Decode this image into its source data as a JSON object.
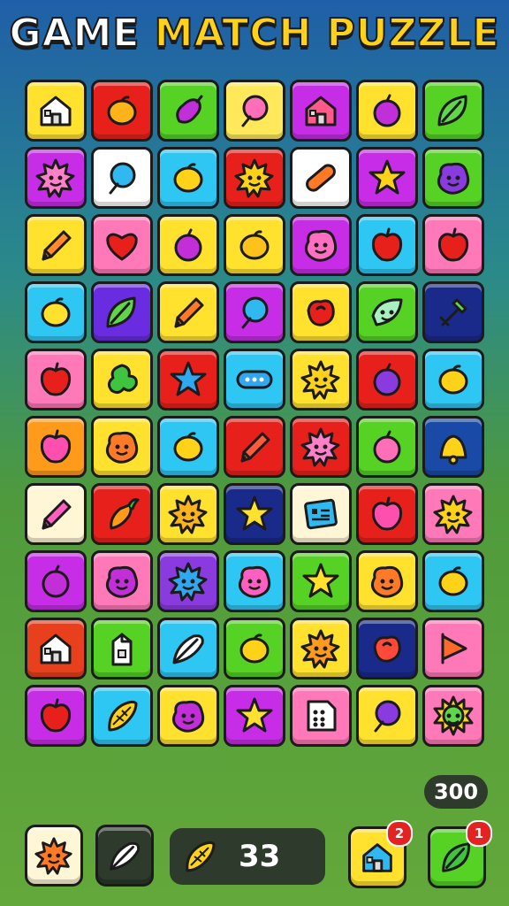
{
  "title": {
    "word1": "GAME",
    "word2": "MATCH PUZZLE"
  },
  "board": {
    "rows": [
      [
        {
          "bg": "#ffe12e",
          "icon": "house-icon",
          "color": "#ffffff"
        },
        {
          "bg": "#e8201c",
          "icon": "lemon-icon",
          "color": "#ffb31a"
        },
        {
          "bg": "#55d224",
          "icon": "eggplant-icon",
          "color": "#c22fd8"
        },
        {
          "bg": "#ffe95a",
          "icon": "balloon-icon",
          "color": "#ff6fb8"
        },
        {
          "bg": "#c72ce6",
          "icon": "house-icon",
          "color": "#ff5a8a"
        },
        {
          "bg": "#ffe12e",
          "icon": "plum-icon",
          "color": "#c22fd8"
        },
        {
          "bg": "#55d224",
          "icon": "leaf-icon",
          "color": "#62d64b"
        }
      ],
      [
        {
          "bg": "#c72ce6",
          "icon": "sun-face-icon",
          "color": "#ff7fc9"
        },
        {
          "bg": "#ffffff",
          "icon": "balloon-icon",
          "color": "#30b9f0"
        },
        {
          "bg": "#2ec6f2",
          "icon": "lemon-icon",
          "color": "#ffd21a"
        },
        {
          "bg": "#e8201c",
          "icon": "sun-face-icon",
          "color": "#ffd21a"
        },
        {
          "bg": "#ffffff",
          "icon": "sausage-icon",
          "color": "#ff7a26"
        },
        {
          "bg": "#c72ce6",
          "icon": "star-icon",
          "color": "#ffd21a"
        },
        {
          "bg": "#55d224",
          "icon": "blob-face-icon",
          "color": "#8a3be0"
        }
      ],
      [
        {
          "bg": "#ffe12e",
          "icon": "pencil-icon",
          "color": "#ff8b2a"
        },
        {
          "bg": "#ff78b8",
          "icon": "heart-icon",
          "color": "#e8201c"
        },
        {
          "bg": "#ffe12e",
          "icon": "plum-icon",
          "color": "#c22fd8"
        },
        {
          "bg": "#ffe12e",
          "icon": "lemon-icon",
          "color": "#ffc21a"
        },
        {
          "bg": "#c72ce6",
          "icon": "blob-face-icon",
          "color": "#ff6fc1"
        },
        {
          "bg": "#2ec6f2",
          "icon": "apple-icon",
          "color": "#e8201c"
        },
        {
          "bg": "#ff78b8",
          "icon": "apple-icon",
          "color": "#e8201c"
        }
      ],
      [
        {
          "bg": "#2ec6f2",
          "icon": "lemon-icon",
          "color": "#ffe12e"
        },
        {
          "bg": "#6a2ce0",
          "icon": "leaf-icon",
          "color": "#62d64b"
        },
        {
          "bg": "#ffe12e",
          "icon": "pencil-icon",
          "color": "#ff7a26"
        },
        {
          "bg": "#c72ce6",
          "icon": "balloon-icon",
          "color": "#30b9f0"
        },
        {
          "bg": "#ffe12e",
          "icon": "rose-icon",
          "color": "#e8201c"
        },
        {
          "bg": "#55d224",
          "icon": "leaf-face-icon",
          "color": "#a8f0c0"
        },
        {
          "bg": "#1a2a8a",
          "icon": "tool-icon",
          "color": "#ffffff"
        }
      ],
      [
        {
          "bg": "#ff78b8",
          "icon": "apple-icon",
          "color": "#e8201c"
        },
        {
          "bg": "#ffe12e",
          "icon": "clover-icon",
          "color": "#3ec43e"
        },
        {
          "bg": "#e8201c",
          "icon": "star-icon",
          "color": "#30a8f0"
        },
        {
          "bg": "#2ec6f2",
          "icon": "capsule-icon",
          "color": "#30a8f0"
        },
        {
          "bg": "#ffe12e",
          "icon": "sun-face-icon",
          "color": "#ffd21a"
        },
        {
          "bg": "#e8201c",
          "icon": "plum-icon",
          "color": "#8a3be0"
        },
        {
          "bg": "#2ec6f2",
          "icon": "lemon-icon",
          "color": "#ffd21a"
        }
      ],
      [
        {
          "bg": "#ff9a1a",
          "icon": "apple-icon",
          "color": "#ff4fae"
        },
        {
          "bg": "#ffe12e",
          "icon": "blob-face-icon",
          "color": "#ff7a26"
        },
        {
          "bg": "#2ec6f2",
          "icon": "lemon-icon",
          "color": "#ffd21a"
        },
        {
          "bg": "#e8201c",
          "icon": "pencil-icon",
          "color": "#ff5a3a"
        },
        {
          "bg": "#e8201c",
          "icon": "sun-face-icon",
          "color": "#ff7fc9"
        },
        {
          "bg": "#55d224",
          "icon": "plum-icon",
          "color": "#ff6fb8"
        },
        {
          "bg": "#1a4aa8",
          "icon": "bell-icon",
          "color": "#ffd21a"
        }
      ],
      [
        {
          "bg": "#fff6d6",
          "icon": "pencil-icon",
          "color": "#ff5fc0"
        },
        {
          "bg": "#e8201c",
          "icon": "carrot-icon",
          "color": "#ff9a1a"
        },
        {
          "bg": "#ffe12e",
          "icon": "sun-face-icon",
          "color": "#ffb31a"
        },
        {
          "bg": "#1a2a8a",
          "icon": "star-icon",
          "color": "#ffe12e"
        },
        {
          "bg": "#fff6d6",
          "icon": "card-icon",
          "color": "#30b9f0"
        },
        {
          "bg": "#e8201c",
          "icon": "apple-icon",
          "color": "#ff4fae"
        },
        {
          "bg": "#ff78b8",
          "icon": "sun-face-icon",
          "color": "#ffd21a"
        }
      ],
      [
        {
          "bg": "#c72ce6",
          "icon": "plum-icon",
          "color": "#c22fd8"
        },
        {
          "bg": "#ff78b8",
          "icon": "blob-face-icon",
          "color": "#c22fd8"
        },
        {
          "bg": "#8a3be0",
          "icon": "sun-face-icon",
          "color": "#30a8f0"
        },
        {
          "bg": "#2ec6f2",
          "icon": "blob-face-icon",
          "color": "#ff5fc0"
        },
        {
          "bg": "#55d224",
          "icon": "star-icon",
          "color": "#ffe12e"
        },
        {
          "bg": "#ffe12e",
          "icon": "blob-face-icon",
          "color": "#ff7a26"
        },
        {
          "bg": "#2ec6f2",
          "icon": "lemon-icon",
          "color": "#ffd21a"
        }
      ],
      [
        {
          "bg": "#e8401c",
          "icon": "house-icon",
          "color": "#ffffff"
        },
        {
          "bg": "#55d224",
          "icon": "milk-carton-icon",
          "color": "#ffffff"
        },
        {
          "bg": "#2ec6f2",
          "icon": "feather-icon",
          "color": "#ffffff"
        },
        {
          "bg": "#55d224",
          "icon": "lemon-icon",
          "color": "#ffd21a"
        },
        {
          "bg": "#ffe12e",
          "icon": "sun-face-icon",
          "color": "#ff9a1a"
        },
        {
          "bg": "#1a2a8a",
          "icon": "rose-icon",
          "color": "#ff4a3a"
        },
        {
          "bg": "#ff78b8",
          "icon": "flag-icon",
          "color": "#ff6a2a"
        }
      ],
      [
        {
          "bg": "#c72ce6",
          "icon": "apple-icon",
          "color": "#e8201c"
        },
        {
          "bg": "#2ec6f2",
          "icon": "corn-icon",
          "color": "#ffd21a"
        },
        {
          "bg": "#ffe12e",
          "icon": "blob-face-icon",
          "color": "#c22fd8"
        },
        {
          "bg": "#c72ce6",
          "icon": "star-icon",
          "color": "#ffe12e"
        },
        {
          "bg": "#ff78b8",
          "icon": "dice-icon",
          "color": "#ffffff"
        },
        {
          "bg": "#ffe12e",
          "icon": "balloon-icon",
          "color": "#8a3be0"
        },
        {
          "bg": "#ff78b8",
          "icon": "virus-face-icon",
          "color": "#62d64b"
        }
      ]
    ]
  },
  "score": {
    "value": "300"
  },
  "toolbar": {
    "slot1": {
      "bg": "#fff6d6",
      "icon": "sun-face-icon",
      "color": "#ff7a26"
    },
    "slot2": {
      "bg": "#2d3a2c",
      "icon": "feather-icon",
      "color": "#ffffff"
    },
    "counter": {
      "icon": "corn-icon",
      "color": "#ffd21a",
      "value": "33"
    },
    "house_button": {
      "bg": "#ffe12e",
      "icon": "house-icon",
      "color": "#30b9f0",
      "badge": "2"
    },
    "leaf_button": {
      "bg": "#55d224",
      "icon": "leaf-icon",
      "color": "#3ec43e",
      "badge": "1"
    }
  },
  "colors": {
    "outline": "#1b1b1b",
    "title_white": "#ffffff",
    "title_yellow": "#ffd21a",
    "badge": "#e52222"
  }
}
